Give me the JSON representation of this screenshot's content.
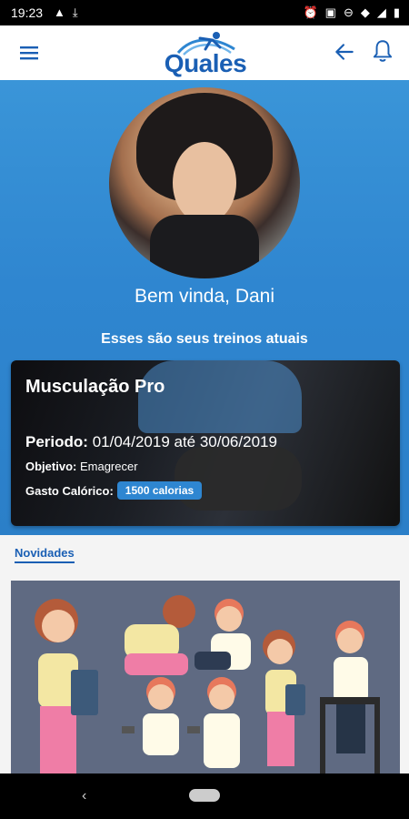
{
  "status_bar": {
    "time": "19:23",
    "icons": [
      "warning-icon",
      "download-icon",
      "alarm-icon",
      "vibrate-icon",
      "dnd-icon",
      "wifi-icon",
      "signal-icon",
      "battery-icon"
    ]
  },
  "app_bar": {
    "logo_text": "Quales",
    "menu_icon": "menu-icon",
    "back_icon": "arrow-left-icon",
    "bell_icon": "bell-icon"
  },
  "hero": {
    "greeting": "Bem vinda, Dani",
    "subtitle": "Esses são seus treinos atuais"
  },
  "training_card": {
    "title": "Musculação Pro",
    "period_label": "Periodo:",
    "period_value": "01/04/2019 até 30/06/2019",
    "objective_label": "Objetivo:",
    "objective_value": "Emagrecer",
    "calorie_label": "Gasto Calórico:",
    "calorie_value": "1500 calorias"
  },
  "news": {
    "title": "Novidades"
  },
  "colors": {
    "brand": "#1a5fb4",
    "hero_bg": "#3a95d8",
    "badge": "#2e86d1"
  }
}
